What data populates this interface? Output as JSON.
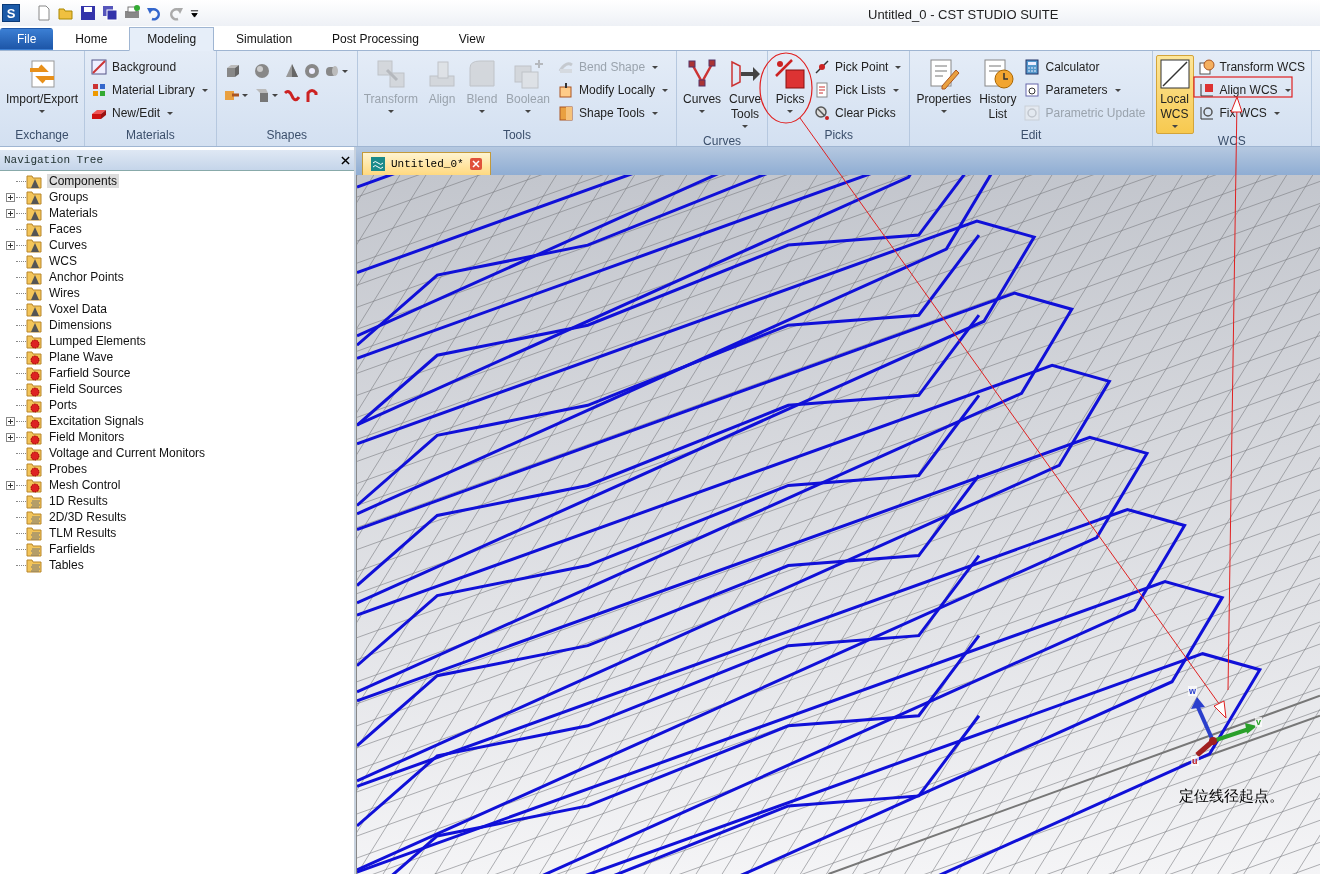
{
  "window": {
    "title": "Untitled_0 - CST STUDIO SUITE",
    "logo_text": "S"
  },
  "tabs": [
    {
      "label": "File",
      "kind": "file",
      "selected": false
    },
    {
      "label": "Home",
      "kind": "tab",
      "selected": false
    },
    {
      "label": "Modeling",
      "kind": "tab",
      "selected": true
    },
    {
      "label": "Simulation",
      "kind": "tab",
      "selected": false
    },
    {
      "label": "Post Processing",
      "kind": "tab",
      "selected": false
    },
    {
      "label": "View",
      "kind": "tab",
      "selected": false
    }
  ],
  "ribbon": [
    {
      "title": "Exchange",
      "items": [
        {
          "label": "Import/Export",
          "kind": "large",
          "dropdown": true,
          "disabled": false,
          "selected": false
        }
      ]
    },
    {
      "title": "Materials",
      "items": [
        {
          "label": "Background",
          "kind": "small",
          "dropdown": false,
          "disabled": false,
          "selected": false
        },
        {
          "label": "Material Library",
          "kind": "small",
          "dropdown": true,
          "disabled": false,
          "selected": false
        },
        {
          "label": "New/Edit",
          "kind": "small",
          "dropdown": true,
          "disabled": false,
          "selected": false
        }
      ]
    },
    {
      "title": "Shapes"
    },
    {
      "title": "Tools",
      "items": [
        {
          "label": "Transform",
          "kind": "large",
          "dropdown": true,
          "disabled": true,
          "selected": false
        },
        {
          "label": "Align",
          "kind": "large",
          "dropdown": false,
          "disabled": true,
          "selected": false
        },
        {
          "label": "Blend",
          "kind": "large",
          "dropdown": true,
          "disabled": true,
          "selected": false
        },
        {
          "label": "Boolean",
          "kind": "large",
          "dropdown": true,
          "disabled": true,
          "selected": false
        },
        {
          "label": "Bend Shape",
          "kind": "small",
          "dropdown": true,
          "disabled": true,
          "selected": false
        },
        {
          "label": "Modify Locally",
          "kind": "small",
          "dropdown": true,
          "disabled": false,
          "selected": false
        },
        {
          "label": "Shape Tools",
          "kind": "small",
          "dropdown": true,
          "disabled": false,
          "selected": false
        }
      ]
    },
    {
      "title": "Curves",
      "items": [
        {
          "label": "Curves",
          "kind": "large",
          "dropdown": true,
          "disabled": false,
          "selected": false
        },
        {
          "label": "Curve Tools",
          "kind": "large",
          "dropdown": true,
          "disabled": false,
          "selected": false
        }
      ]
    },
    {
      "title": "Picks",
      "items": [
        {
          "label": "Picks",
          "kind": "large",
          "dropdown": true,
          "disabled": false,
          "selected": false
        },
        {
          "label": "Pick Point",
          "kind": "small",
          "dropdown": true,
          "disabled": false,
          "selected": false
        },
        {
          "label": "Pick Lists",
          "kind": "small",
          "dropdown": true,
          "disabled": false,
          "selected": false
        },
        {
          "label": "Clear Picks",
          "kind": "small",
          "dropdown": false,
          "disabled": false,
          "selected": false
        }
      ]
    },
    {
      "title": "Edit",
      "items": [
        {
          "label": "Properties",
          "kind": "large",
          "dropdown": true,
          "disabled": false,
          "selected": false
        },
        {
          "label": "History List",
          "kind": "large",
          "dropdown": false,
          "disabled": false,
          "selected": false
        },
        {
          "label": "Calculator",
          "kind": "small",
          "dropdown": false,
          "disabled": false,
          "selected": false
        },
        {
          "label": "Parameters",
          "kind": "small",
          "dropdown": true,
          "disabled": false,
          "selected": false
        },
        {
          "label": "Parametric Update",
          "kind": "small",
          "dropdown": false,
          "disabled": true,
          "selected": false
        }
      ]
    },
    {
      "title": "WCS",
      "items": [
        {
          "label": "Local WCS",
          "kind": "large",
          "dropdown": true,
          "disabled": false,
          "selected": true
        },
        {
          "label": "Transform WCS",
          "kind": "small",
          "dropdown": false,
          "disabled": false,
          "selected": false
        },
        {
          "label": "Align WCS",
          "kind": "small",
          "dropdown": true,
          "disabled": false,
          "selected": false
        },
        {
          "label": "Fix WCS",
          "kind": "small",
          "dropdown": true,
          "disabled": false,
          "selected": false
        }
      ]
    }
  ],
  "navigation_tree": {
    "title": "Navigation Tree",
    "items": [
      {
        "label": "Components",
        "kind": "model",
        "expandable": false,
        "selected": true
      },
      {
        "label": "Groups",
        "kind": "model",
        "expandable": true,
        "selected": false
      },
      {
        "label": "Materials",
        "kind": "model",
        "expandable": true,
        "selected": false
      },
      {
        "label": "Faces",
        "kind": "model",
        "expandable": false,
        "selected": false
      },
      {
        "label": "Curves",
        "kind": "model",
        "expandable": true,
        "selected": false
      },
      {
        "label": "WCS",
        "kind": "model",
        "expandable": false,
        "selected": false
      },
      {
        "label": "Anchor Points",
        "kind": "model",
        "expandable": false,
        "selected": false
      },
      {
        "label": "Wires",
        "kind": "model",
        "expandable": false,
        "selected": false
      },
      {
        "label": "Voxel Data",
        "kind": "model",
        "expandable": false,
        "selected": false
      },
      {
        "label": "Dimensions",
        "kind": "model",
        "expandable": false,
        "selected": false
      },
      {
        "label": "Lumped Elements",
        "kind": "source",
        "expandable": false,
        "selected": false
      },
      {
        "label": "Plane Wave",
        "kind": "source",
        "expandable": false,
        "selected": false
      },
      {
        "label": "Farfield Source",
        "kind": "source",
        "expandable": false,
        "selected": false
      },
      {
        "label": "Field Sources",
        "kind": "source",
        "expandable": false,
        "selected": false
      },
      {
        "label": "Ports",
        "kind": "source",
        "expandable": false,
        "selected": false
      },
      {
        "label": "Excitation Signals",
        "kind": "source",
        "expandable": true,
        "selected": false
      },
      {
        "label": "Field Monitors",
        "kind": "source",
        "expandable": true,
        "selected": false
      },
      {
        "label": "Voltage and Current Monitors",
        "kind": "source",
        "expandable": false,
        "selected": false
      },
      {
        "label": "Probes",
        "kind": "source",
        "expandable": false,
        "selected": false
      },
      {
        "label": "Mesh Control",
        "kind": "source",
        "expandable": true,
        "selected": false
      },
      {
        "label": "1D Results",
        "kind": "result",
        "expandable": false,
        "selected": false
      },
      {
        "label": "2D/3D Results",
        "kind": "result",
        "expandable": false,
        "selected": false
      },
      {
        "label": "TLM Results",
        "kind": "result",
        "expandable": false,
        "selected": false
      },
      {
        "label": "Farfields",
        "kind": "result",
        "expandable": false,
        "selected": false
      },
      {
        "label": "Tables",
        "kind": "result",
        "expandable": false,
        "selected": false
      }
    ]
  },
  "document_tab": {
    "title": "Untitled_0*"
  },
  "viewport": {
    "axes": {
      "u": "u",
      "v": "v",
      "w": "w"
    },
    "annotation": "定位线径起点。"
  }
}
